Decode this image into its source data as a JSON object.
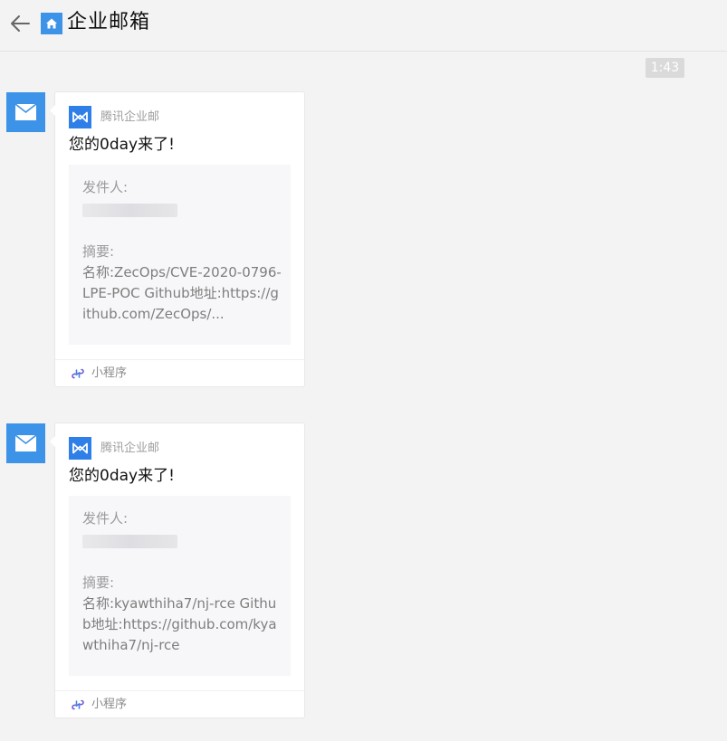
{
  "header": {
    "title": "企业邮箱"
  },
  "time": "1:43",
  "messages": [
    {
      "brand": "腾讯企业邮",
      "title": "您的0day来了!",
      "sender_label": "发件人:",
      "summary_label": "摘要:",
      "summary": "名称:ZecOps/CVE-2020-0796-LPE-POC Github地址:https://github.com/ZecOps/...",
      "footer_label": "小程序"
    },
    {
      "brand": "腾讯企业邮",
      "title": "您的0day来了!",
      "sender_label": "发件人:",
      "summary_label": "摘要:",
      "summary": "名称:kyawthiha7/nj-rce Github地址:https://github.com/kyawthiha7/nj-rce",
      "footer_label": "小程序"
    }
  ],
  "colors": {
    "accent": "#3d93e8",
    "brand": "#2f7fe8",
    "background": "#f3f3f3"
  },
  "icons": {
    "back": "arrow-left-icon",
    "home": "home-icon",
    "avatar": "mail-envelope-icon",
    "brand": "tencent-exmail-logo-icon",
    "mini_program": "mini-program-link-icon"
  }
}
